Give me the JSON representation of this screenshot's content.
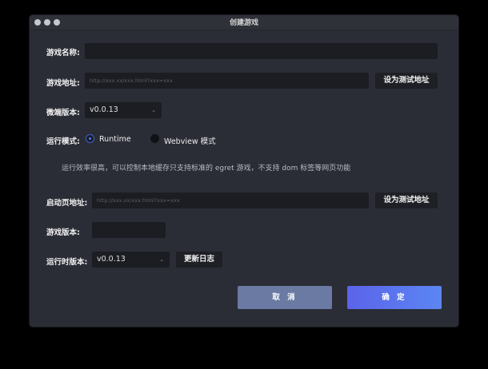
{
  "window": {
    "title": "创建游戏"
  },
  "form": {
    "game_name": {
      "label": "游戏名称:",
      "value": ""
    },
    "game_url": {
      "label": "游戏地址:",
      "placeholder": "http://xxx.xx/xxx.html?xxx=xxx",
      "test_button": "设为测试地址"
    },
    "client_version": {
      "label": "微端版本:",
      "selected": "v0.0.13"
    },
    "run_mode": {
      "label": "运行模式:",
      "options": [
        {
          "label": "Runtime",
          "selected": true
        },
        {
          "label": "Webview 模式",
          "selected": false
        }
      ],
      "hint": "运行效率很高，可以控制本地缓存只支持标准的 egret 游戏，不支持 dom 标签等网页功能"
    },
    "launch_url": {
      "label": "启动页地址:",
      "placeholder": "http://xxx.xx/xxx.html?xxx=xxx",
      "test_button": "设为测试地址"
    },
    "game_version": {
      "label": "游戏版本:",
      "value": ""
    },
    "runtime_version": {
      "label": "运行时版本:",
      "selected": "v0.0.13",
      "changelog_button": "更新日志"
    }
  },
  "actions": {
    "cancel": "取 消",
    "confirm": "确 定"
  },
  "colors": {
    "cancel_bg": "#6b7aa3",
    "confirm_bg": "#5b6cf0",
    "radio_selected": "#4f7bff"
  }
}
